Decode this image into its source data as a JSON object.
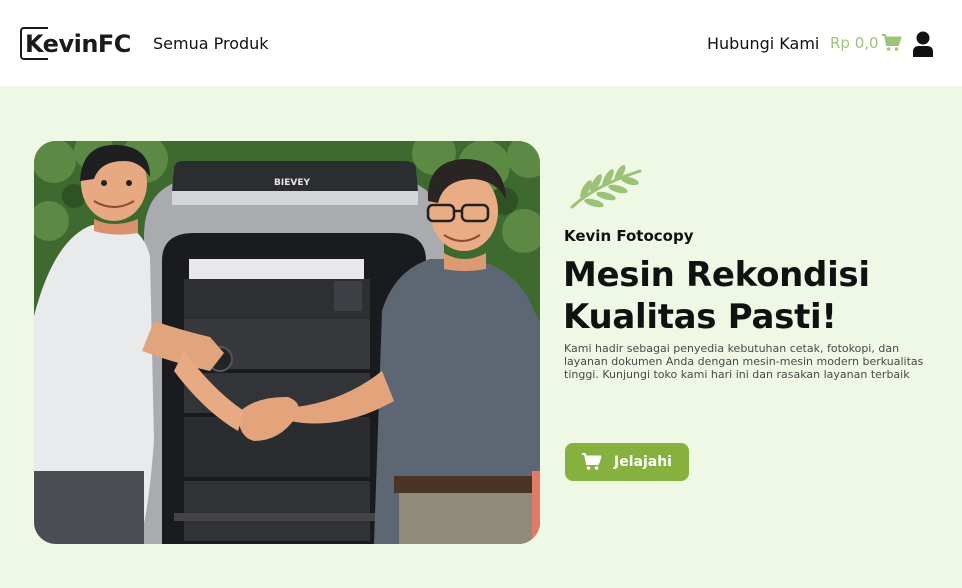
{
  "brand": {
    "logo_text": "KevinFC"
  },
  "nav": {
    "products_label": "Semua Produk",
    "contact_label": "Hubungi Kami",
    "cart_total": "Rp 0,0"
  },
  "icons": {
    "cart": "cart-icon",
    "user": "user-icon",
    "leaf": "leaf-icon"
  },
  "hero": {
    "subtitle": "Kevin Fotocopy",
    "title": "Mesin Rekondisi Kualitas Pasti!",
    "description": "Kami hadir sebagai penyedia kebutuhan cetak, fotokopi, dan layanan dokumen Anda dengan mesin-mesin modern berkualitas tinggi. Kunjungi toko kami hari ini dan rasakan layanan terbaik",
    "cta_label": "Jelajahi",
    "machine_brand_text": "BIEVEY"
  },
  "colors": {
    "accent": "#86b13f",
    "cart_price": "#9cc57a",
    "hero_background": "#eef8e4"
  }
}
